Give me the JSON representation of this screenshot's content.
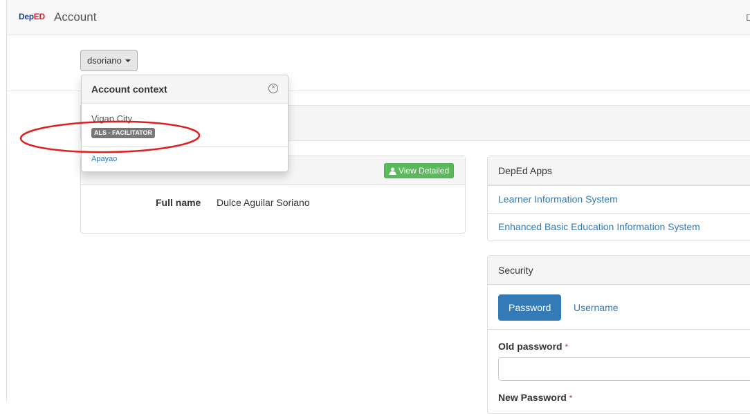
{
  "navbar": {
    "logo_part1": "Dep",
    "logo_part2": "ED",
    "title": "Account",
    "right_text": "D"
  },
  "user_menu": {
    "username": "dsoriano"
  },
  "account_context": {
    "header": "Account context",
    "items": [
      {
        "location": "Vigan City",
        "role": "ALS - FACILITATOR"
      },
      {
        "location": "Apayao"
      }
    ]
  },
  "profile": {
    "view_detailed_label": "View Detailed",
    "full_name_label": "Full name",
    "full_name_value": "Dulce Aguilar Soriano"
  },
  "apps": {
    "title": "DepEd Apps",
    "links": [
      "Learner Information System",
      "Enhanced Basic Education Information System"
    ]
  },
  "security": {
    "title": "Security",
    "tabs": [
      "Password",
      "Username"
    ],
    "old_password_label": "Old password",
    "new_password_label": "New Password",
    "required_mark": "*"
  },
  "colors": {
    "primary": "#337ab7",
    "success": "#5cb85c",
    "badge": "#777777",
    "annotation": "#e02020"
  }
}
